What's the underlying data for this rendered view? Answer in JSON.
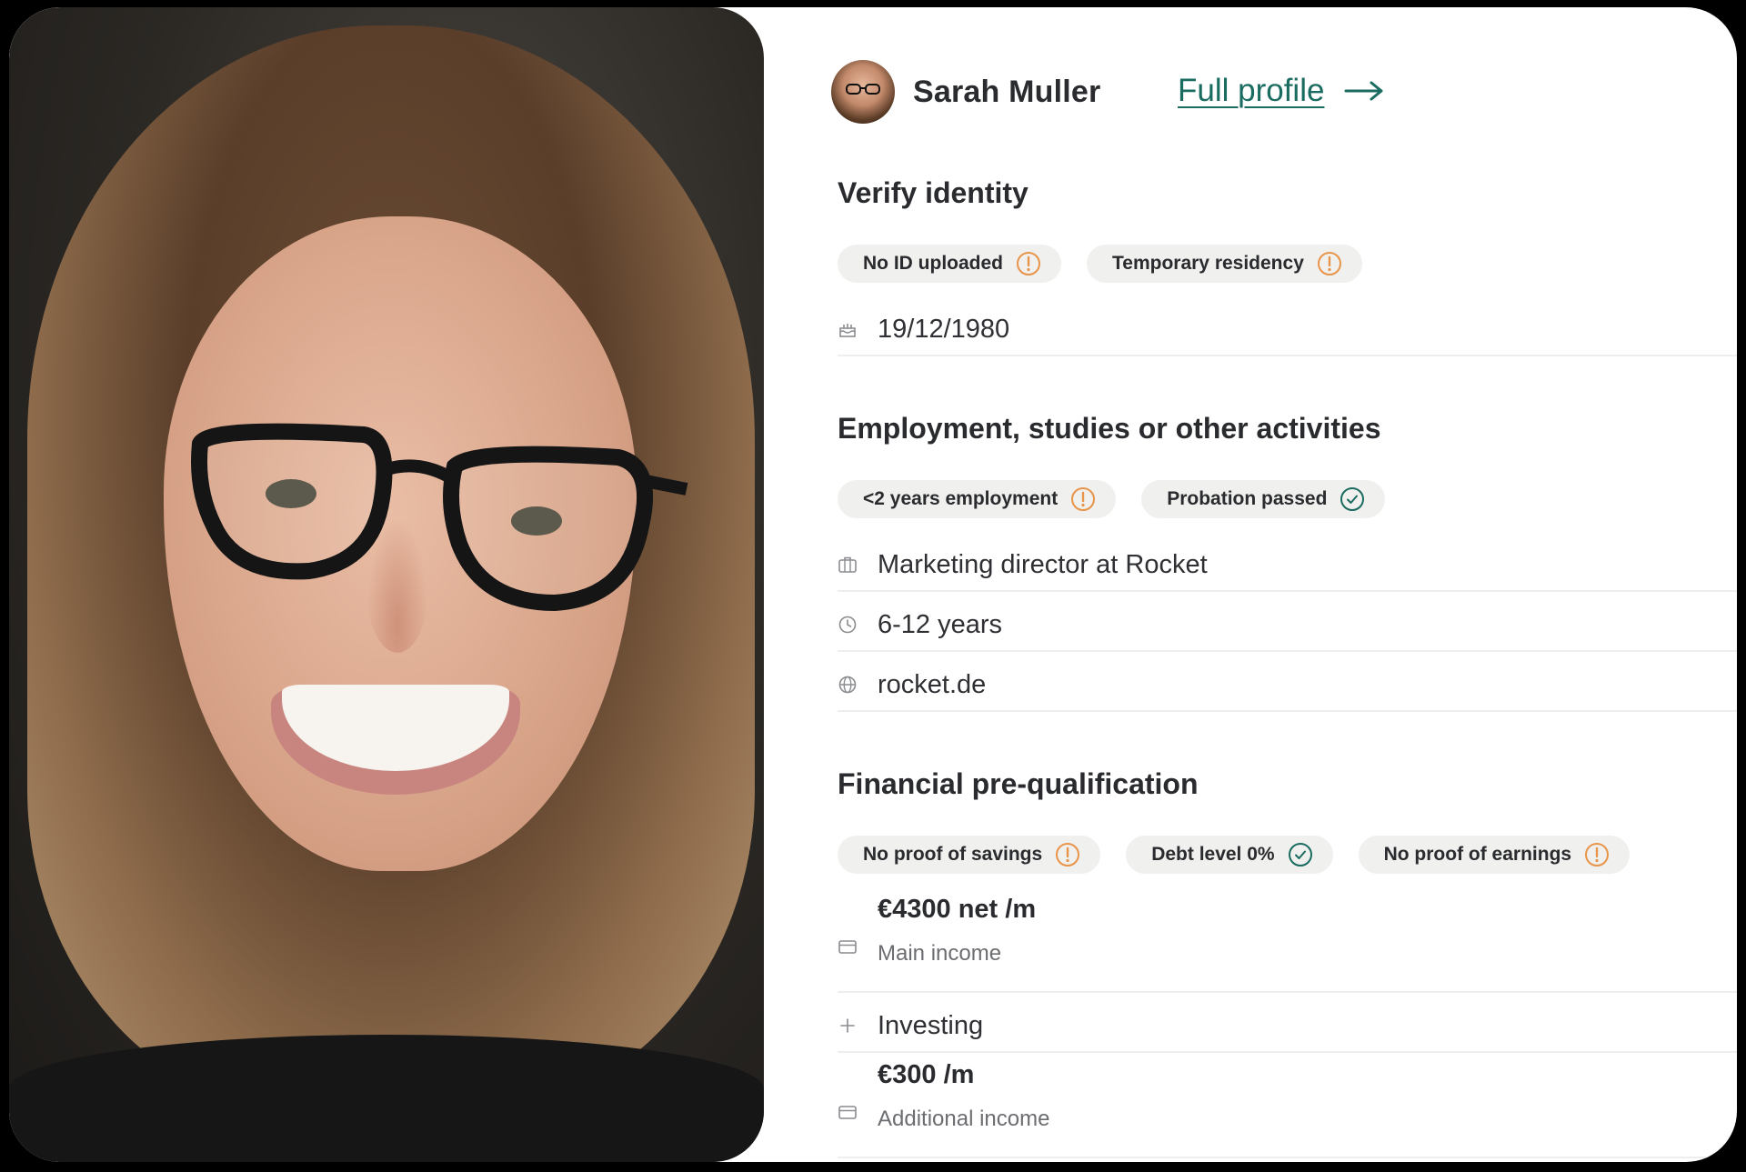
{
  "user": {
    "name": "Sarah Muller",
    "full_profile_label": "Full profile"
  },
  "sections": {
    "identity": {
      "title": "Verify identity",
      "chips": [
        {
          "label": "No ID uploaded",
          "status": "warning"
        },
        {
          "label": "Temporary residency",
          "status": "warning"
        }
      ],
      "birthdate": "19/12/1980"
    },
    "employment": {
      "title": "Employment, studies or other activities",
      "chips": [
        {
          "label": "<2 years employment",
          "status": "warning"
        },
        {
          "label": "Probation passed",
          "status": "ok"
        }
      ],
      "job": "Marketing director at Rocket",
      "duration": "6-12 years",
      "website": "rocket.de"
    },
    "financial": {
      "title": "Financial pre-qualification",
      "chips": [
        {
          "label": "No proof of savings",
          "status": "warning"
        },
        {
          "label": "Debt level 0%",
          "status": "ok"
        },
        {
          "label": "No proof of earnings",
          "status": "warning"
        }
      ],
      "main_income": {
        "amount": "€4300 net /m",
        "label": "Main income"
      },
      "investing_label": "Investing",
      "additional_income": {
        "amount": "€300 /m",
        "label": "Additional income"
      }
    }
  },
  "icons": {
    "warning": "warning-icon",
    "ok": "check-circle-icon",
    "birthdate": "cake-icon",
    "job": "briefcase-icon",
    "duration": "clock-icon",
    "website": "globe-icon",
    "income": "credit-card-icon",
    "add": "plus-icon"
  },
  "colors": {
    "warning": "#e8944a",
    "ok": "#1a6b60",
    "link": "#1a6b60",
    "chip_bg": "#f0f0ee"
  }
}
